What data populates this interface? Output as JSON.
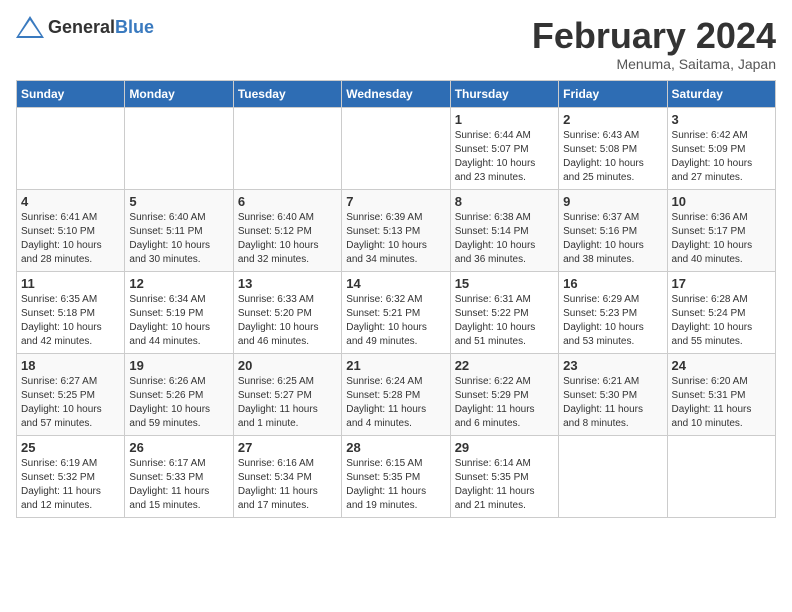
{
  "header": {
    "logo_general": "General",
    "logo_blue": "Blue",
    "title": "February 2024",
    "subtitle": "Menuma, Saitama, Japan"
  },
  "days_of_week": [
    "Sunday",
    "Monday",
    "Tuesday",
    "Wednesday",
    "Thursday",
    "Friday",
    "Saturday"
  ],
  "weeks": [
    [
      {
        "day": "",
        "info": ""
      },
      {
        "day": "",
        "info": ""
      },
      {
        "day": "",
        "info": ""
      },
      {
        "day": "",
        "info": ""
      },
      {
        "day": "1",
        "info": "Sunrise: 6:44 AM\nSunset: 5:07 PM\nDaylight: 10 hours\nand 23 minutes."
      },
      {
        "day": "2",
        "info": "Sunrise: 6:43 AM\nSunset: 5:08 PM\nDaylight: 10 hours\nand 25 minutes."
      },
      {
        "day": "3",
        "info": "Sunrise: 6:42 AM\nSunset: 5:09 PM\nDaylight: 10 hours\nand 27 minutes."
      }
    ],
    [
      {
        "day": "4",
        "info": "Sunrise: 6:41 AM\nSunset: 5:10 PM\nDaylight: 10 hours\nand 28 minutes."
      },
      {
        "day": "5",
        "info": "Sunrise: 6:40 AM\nSunset: 5:11 PM\nDaylight: 10 hours\nand 30 minutes."
      },
      {
        "day": "6",
        "info": "Sunrise: 6:40 AM\nSunset: 5:12 PM\nDaylight: 10 hours\nand 32 minutes."
      },
      {
        "day": "7",
        "info": "Sunrise: 6:39 AM\nSunset: 5:13 PM\nDaylight: 10 hours\nand 34 minutes."
      },
      {
        "day": "8",
        "info": "Sunrise: 6:38 AM\nSunset: 5:14 PM\nDaylight: 10 hours\nand 36 minutes."
      },
      {
        "day": "9",
        "info": "Sunrise: 6:37 AM\nSunset: 5:16 PM\nDaylight: 10 hours\nand 38 minutes."
      },
      {
        "day": "10",
        "info": "Sunrise: 6:36 AM\nSunset: 5:17 PM\nDaylight: 10 hours\nand 40 minutes."
      }
    ],
    [
      {
        "day": "11",
        "info": "Sunrise: 6:35 AM\nSunset: 5:18 PM\nDaylight: 10 hours\nand 42 minutes."
      },
      {
        "day": "12",
        "info": "Sunrise: 6:34 AM\nSunset: 5:19 PM\nDaylight: 10 hours\nand 44 minutes."
      },
      {
        "day": "13",
        "info": "Sunrise: 6:33 AM\nSunset: 5:20 PM\nDaylight: 10 hours\nand 46 minutes."
      },
      {
        "day": "14",
        "info": "Sunrise: 6:32 AM\nSunset: 5:21 PM\nDaylight: 10 hours\nand 49 minutes."
      },
      {
        "day": "15",
        "info": "Sunrise: 6:31 AM\nSunset: 5:22 PM\nDaylight: 10 hours\nand 51 minutes."
      },
      {
        "day": "16",
        "info": "Sunrise: 6:29 AM\nSunset: 5:23 PM\nDaylight: 10 hours\nand 53 minutes."
      },
      {
        "day": "17",
        "info": "Sunrise: 6:28 AM\nSunset: 5:24 PM\nDaylight: 10 hours\nand 55 minutes."
      }
    ],
    [
      {
        "day": "18",
        "info": "Sunrise: 6:27 AM\nSunset: 5:25 PM\nDaylight: 10 hours\nand 57 minutes."
      },
      {
        "day": "19",
        "info": "Sunrise: 6:26 AM\nSunset: 5:26 PM\nDaylight: 10 hours\nand 59 minutes."
      },
      {
        "day": "20",
        "info": "Sunrise: 6:25 AM\nSunset: 5:27 PM\nDaylight: 11 hours\nand 1 minute."
      },
      {
        "day": "21",
        "info": "Sunrise: 6:24 AM\nSunset: 5:28 PM\nDaylight: 11 hours\nand 4 minutes."
      },
      {
        "day": "22",
        "info": "Sunrise: 6:22 AM\nSunset: 5:29 PM\nDaylight: 11 hours\nand 6 minutes."
      },
      {
        "day": "23",
        "info": "Sunrise: 6:21 AM\nSunset: 5:30 PM\nDaylight: 11 hours\nand 8 minutes."
      },
      {
        "day": "24",
        "info": "Sunrise: 6:20 AM\nSunset: 5:31 PM\nDaylight: 11 hours\nand 10 minutes."
      }
    ],
    [
      {
        "day": "25",
        "info": "Sunrise: 6:19 AM\nSunset: 5:32 PM\nDaylight: 11 hours\nand 12 minutes."
      },
      {
        "day": "26",
        "info": "Sunrise: 6:17 AM\nSunset: 5:33 PM\nDaylight: 11 hours\nand 15 minutes."
      },
      {
        "day": "27",
        "info": "Sunrise: 6:16 AM\nSunset: 5:34 PM\nDaylight: 11 hours\nand 17 minutes."
      },
      {
        "day": "28",
        "info": "Sunrise: 6:15 AM\nSunset: 5:35 PM\nDaylight: 11 hours\nand 19 minutes."
      },
      {
        "day": "29",
        "info": "Sunrise: 6:14 AM\nSunset: 5:35 PM\nDaylight: 11 hours\nand 21 minutes."
      },
      {
        "day": "",
        "info": ""
      },
      {
        "day": "",
        "info": ""
      }
    ]
  ]
}
